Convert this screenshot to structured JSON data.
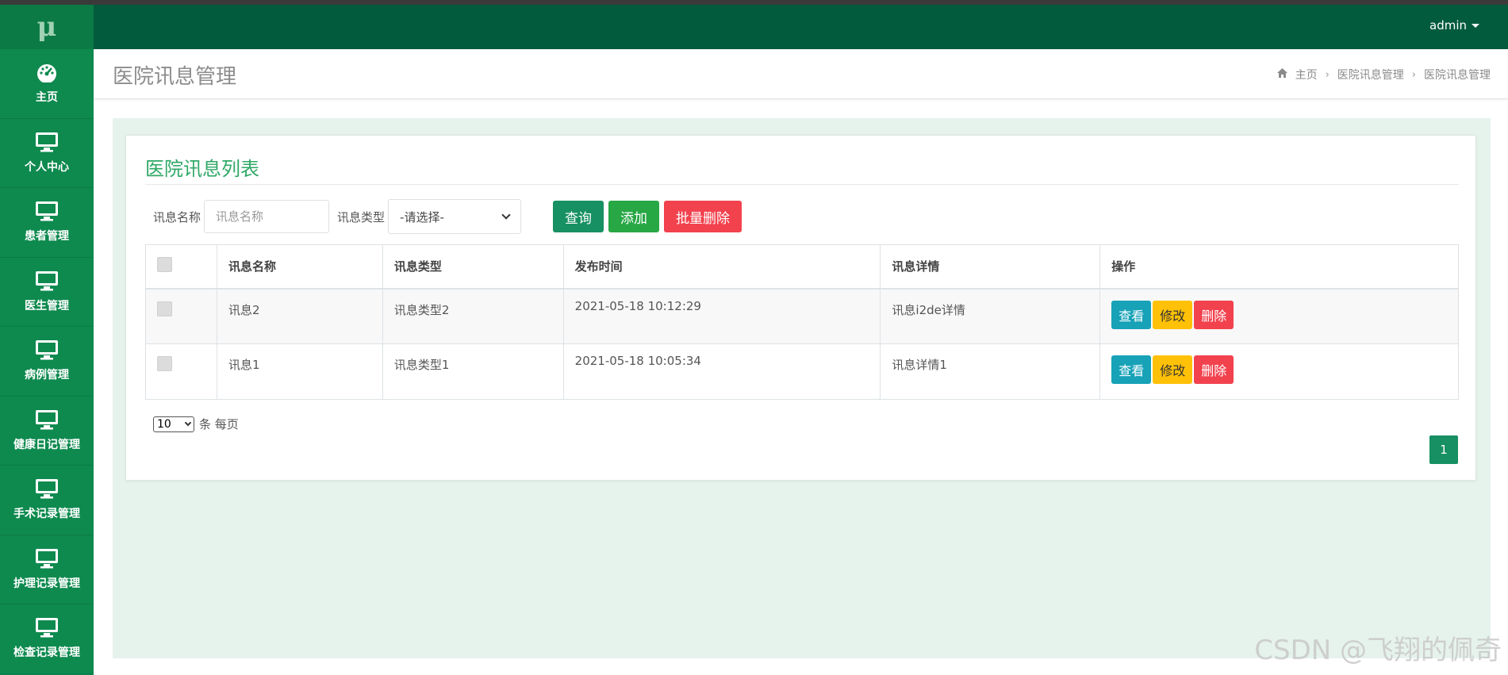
{
  "app": {
    "logo": "μ",
    "user": "admin"
  },
  "sidebar": {
    "items": [
      {
        "label": "主页",
        "icon": "dashboard-icon"
      },
      {
        "label": "个人中心",
        "icon": "monitor-icon"
      },
      {
        "label": "患者管理",
        "icon": "monitor-icon"
      },
      {
        "label": "医生管理",
        "icon": "monitor-icon"
      },
      {
        "label": "病例管理",
        "icon": "monitor-icon"
      },
      {
        "label": "健康日记管理",
        "icon": "monitor-icon"
      },
      {
        "label": "手术记录管理",
        "icon": "monitor-icon"
      },
      {
        "label": "护理记录管理",
        "icon": "monitor-icon"
      },
      {
        "label": "检查记录管理",
        "icon": "monitor-icon"
      }
    ]
  },
  "header": {
    "title": "医院讯息管理",
    "breadcrumb": [
      "主页",
      "医院讯息管理",
      "医院讯息管理"
    ]
  },
  "panel": {
    "title": "医院讯息列表",
    "filter": {
      "name_label": "讯息名称",
      "name_placeholder": "讯息名称",
      "type_label": "讯息类型",
      "type_selected": "-请选择-",
      "query_btn": "查询",
      "add_btn": "添加",
      "batch_delete_btn": "批量删除"
    },
    "table": {
      "columns": [
        "讯息名称",
        "讯息类型",
        "发布时间",
        "讯息详情",
        "操作"
      ],
      "rows": [
        {
          "name": "讯息2",
          "type": "讯息类型2",
          "time": "2021-05-18 10:12:29",
          "detail": "讯息i2de详情"
        },
        {
          "name": "讯息1",
          "type": "讯息类型1",
          "time": "2021-05-18 10:05:34",
          "detail": "讯息详情1"
        }
      ],
      "actions": {
        "view": "查看",
        "edit": "修改",
        "delete": "删除"
      }
    },
    "pagination": {
      "page_size": "10",
      "page_size_suffix": "条 每页",
      "current_page": "1"
    }
  },
  "watermark": "CSDN @飞翔的佩奇",
  "colors": {
    "sidebar": "#0e8a4f",
    "topbar": "#035b3d",
    "accent_title": "#2fa866",
    "query": "#179063",
    "add": "#28a745",
    "danger": "#f2424e",
    "info": "#17a2b8",
    "warning": "#ffc107"
  }
}
